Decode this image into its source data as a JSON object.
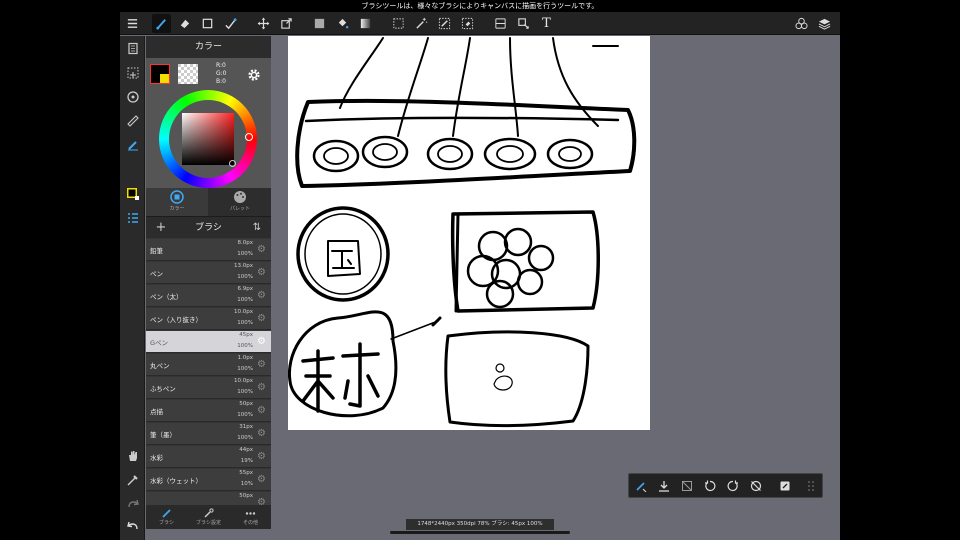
{
  "system_bar": {
    "message": "ブラシツールは、様々なブラシによりキャンバスに描画を行うツールです。"
  },
  "toolbar": {
    "icons": [
      "menu-icon",
      "brush-icon",
      "eraser-icon",
      "square-icon",
      "magic-select-icon",
      "move-icon",
      "transform-icon",
      "fill-color-icon",
      "bucket-icon",
      "gradient-icon",
      "select-rect-icon",
      "magic-wand-icon",
      "select-pen-icon",
      "select-eraser-icon",
      "snap-icon",
      "operation-icon",
      "text-icon",
      "material-icon",
      "layers-icon"
    ],
    "text_tool_glyph": "T"
  },
  "color_panel": {
    "title": "カラー",
    "rgb": {
      "r": "R:0",
      "g": "G:0",
      "b": "B:0"
    },
    "foreground": "#000000",
    "accent": "#f0e000",
    "tabs": [
      {
        "label": "カラー"
      },
      {
        "label": "パレット"
      }
    ]
  },
  "brush_panel": {
    "title": "ブラシ",
    "add_glyph": "+",
    "sort_glyph": "⇅",
    "brushes": [
      {
        "name": "鉛筆",
        "size": "8.0px",
        "opacity": "100%"
      },
      {
        "name": "ペン",
        "size": "13.0px",
        "opacity": "100%"
      },
      {
        "name": "ペン（太）",
        "size": "6.9px",
        "opacity": "100%"
      },
      {
        "name": "ペン（入り抜き）",
        "size": "10.0px",
        "opacity": "100%"
      },
      {
        "name": "Gペン",
        "size": "45px",
        "opacity": "100%",
        "selected": true
      },
      {
        "name": "丸ペン",
        "size": "1.0px",
        "opacity": "100%"
      },
      {
        "name": "ふちペン",
        "size": "10.0px",
        "opacity": "100%"
      },
      {
        "name": "点描",
        "size": "50px",
        "opacity": "100%"
      },
      {
        "name": "筆（墨）",
        "size": "31px",
        "opacity": "100%"
      },
      {
        "name": "水彩",
        "size": "44px",
        "opacity": "19%"
      },
      {
        "name": "水彩（ウェット）",
        "size": "55px",
        "opacity": "10%"
      },
      {
        "name": "",
        "size": "50px",
        "opacity": ""
      }
    ],
    "tabs": [
      {
        "label": "ブラシ"
      },
      {
        "label": "ブラシ設定"
      },
      {
        "label": "その他"
      }
    ]
  },
  "status_bar": {
    "text": "1748*2440px 350dpi 78% ブラシ: 45px 100%"
  }
}
